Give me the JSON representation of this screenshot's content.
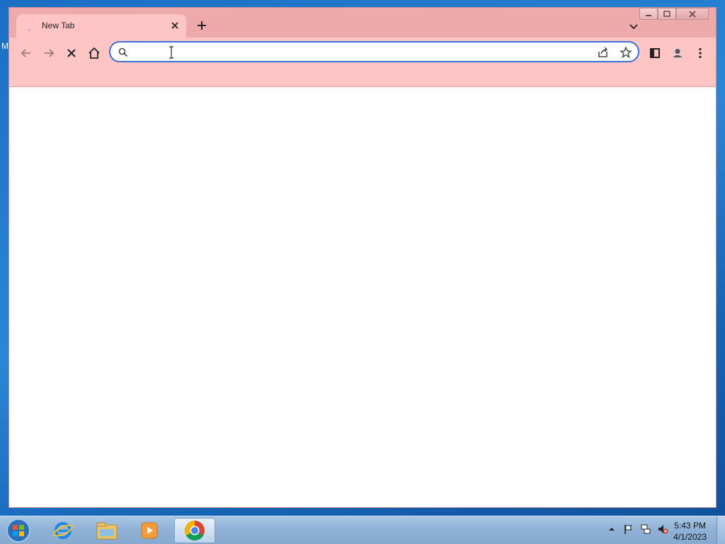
{
  "desktop": {
    "peek_letter": "M"
  },
  "browser": {
    "tab": {
      "title": "New Tab"
    },
    "omnibox": {
      "value": "",
      "placeholder": ""
    }
  },
  "taskbar": {
    "apps": [
      "internet-explorer",
      "windows-explorer",
      "media-player",
      "chrome"
    ],
    "clock": {
      "time": "5:43 PM",
      "date": "4/1/2023"
    }
  },
  "colors": {
    "toolbar": "#ffc4c4",
    "tabstrip": "#eea9ab",
    "omnibox_focus": "#3b6fd8"
  }
}
